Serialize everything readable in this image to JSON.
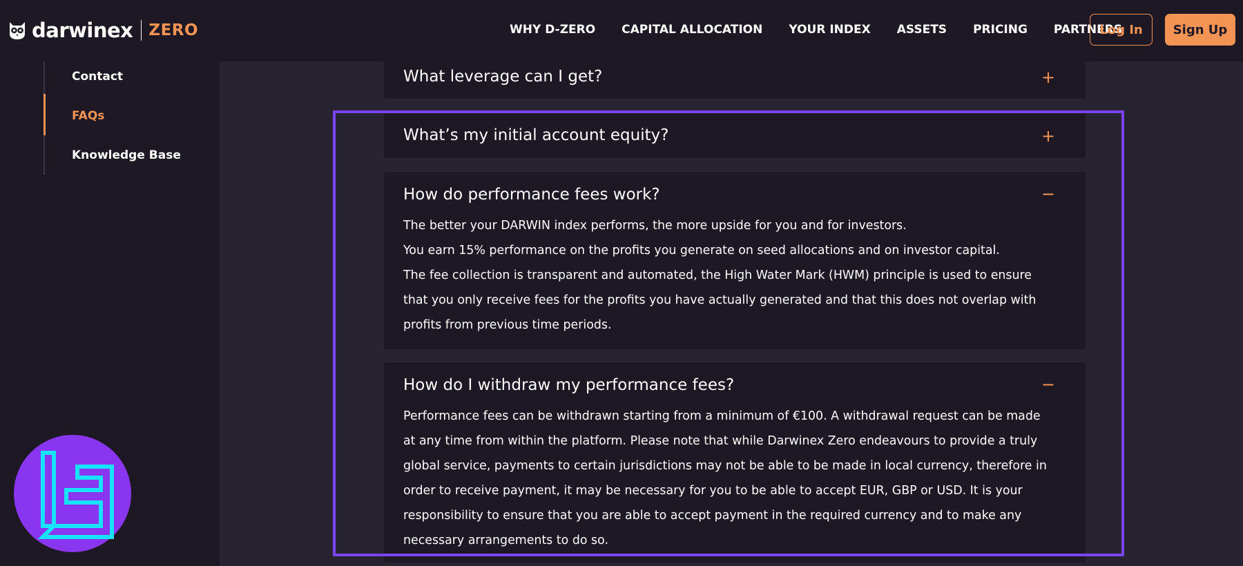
{
  "header": {
    "brand_name": "darwinex",
    "brand_product": "ZERO",
    "nav": [
      "WHY D-ZERO",
      "CAPITAL ALLOCATION",
      "YOUR INDEX",
      "ASSETS",
      "PRICING",
      "PARTNERS"
    ],
    "login_label": "Log In",
    "signup_label": "Sign Up"
  },
  "sidebar": {
    "items": [
      "Contact",
      "FAQs",
      "Knowledge Base"
    ],
    "active": "FAQs"
  },
  "faqs": [
    {
      "question": "What leverage can I get?",
      "toggle": "+",
      "expanded": false
    },
    {
      "question": "What’s my initial account equity?",
      "toggle": "+",
      "expanded": false
    },
    {
      "question": "How do performance fees work?",
      "toggle": "−",
      "expanded": true,
      "answer_lines": [
        "The better your DARWIN index performs, the more upside for you and for investors.",
        "You earn 15% performance on the profits you generate on seed allocations and on investor capital.",
        "The fee collection is transparent and automated, the High Water Mark (HWM) principle is used to ensure",
        "that you only receive fees for the profits you have actually generated and that this does not overlap with",
        "profits from previous time periods."
      ]
    },
    {
      "question": "How do I withdraw my performance fees?",
      "toggle": "−",
      "expanded": true,
      "answer_lines": [
        "Performance fees can be withdrawn starting from a minimum of €100. A withdrawal request can be made",
        "at any time from within the platform. Please note that while Darwinex Zero endeavours to provide a truly",
        "global service, payments to certain jurisdictions may not be able to be made in local currency, therefore in",
        "order to receive payment, it may be necessary for you to be able to accept EUR, GBP or USD. It is your",
        "responsibility to ensure that you are able to accept payment in the required currency and to make any",
        "necessary arrangements to do so."
      ]
    }
  ],
  "colors": {
    "accent": "#f39455",
    "highlight": "#7a44f2",
    "panel": "#1e1825",
    "background": "#272330"
  },
  "icons": {
    "logo": "owl-icon",
    "watermark": "tc-watermark-icon"
  }
}
